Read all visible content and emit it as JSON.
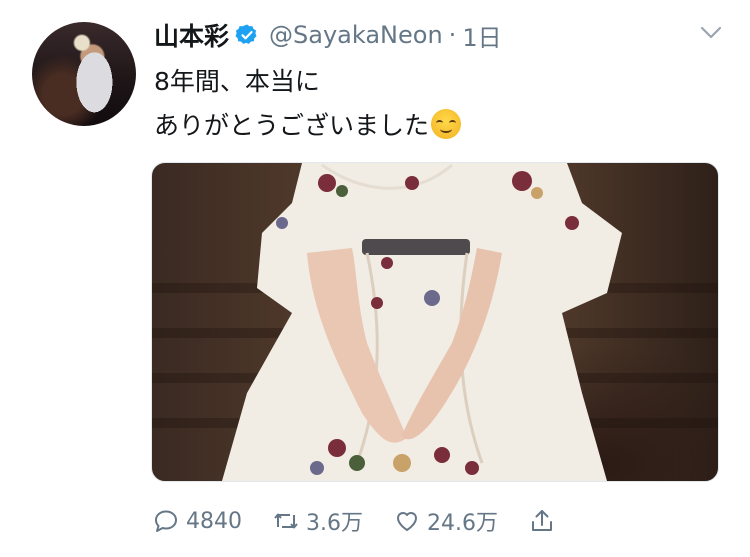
{
  "tweet": {
    "display_name": "山本彩",
    "verified": true,
    "handle": "@SayakaNeon",
    "separator": "·",
    "time": "1日",
    "lines": [
      "8年間、本当に",
      "ありがとうございました"
    ],
    "emoji": "relieved-face-emoji",
    "image_alt": "photo of woman in white floral dress"
  },
  "actions": {
    "replies": "4840",
    "retweets": "3.6万",
    "likes": "24.6万"
  },
  "colors": {
    "text": "#14171a",
    "muted": "#657786",
    "verified": "#1da1f2"
  }
}
